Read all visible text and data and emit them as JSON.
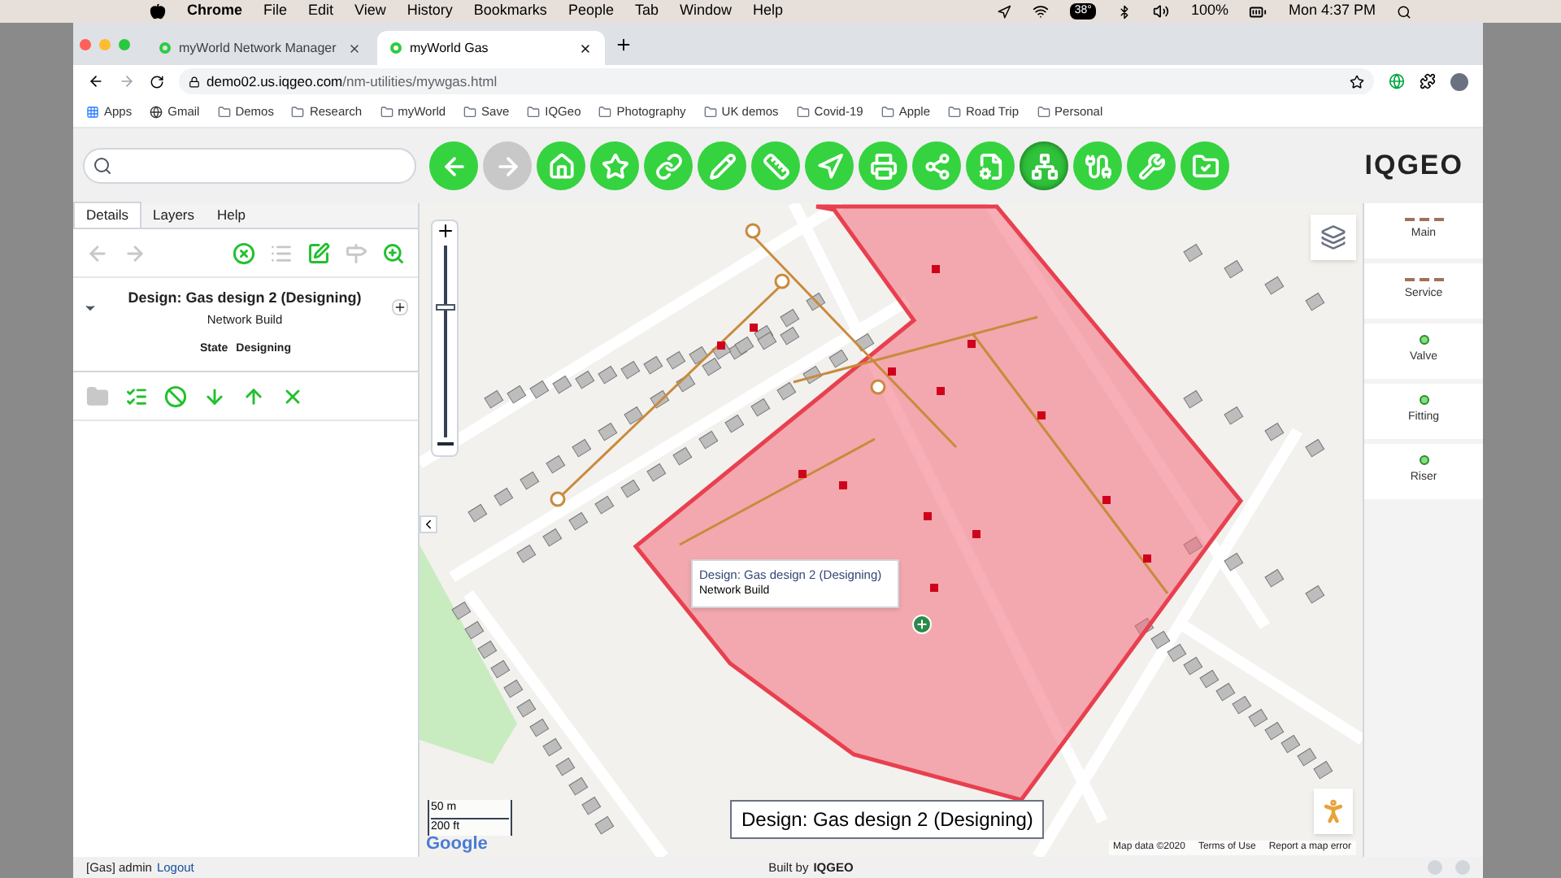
{
  "menu_bar": {
    "app": "Chrome",
    "items": [
      "File",
      "Edit",
      "View",
      "History",
      "Bookmarks",
      "People",
      "Tab",
      "Window",
      "Help"
    ],
    "temperature": "38°",
    "battery": "100%",
    "clock": "Mon 4:37 PM"
  },
  "browser_tabs": [
    {
      "title": "myWorld Network Manager",
      "selected": false
    },
    {
      "title": "myWorld Gas",
      "selected": true
    }
  ],
  "address_bar": {
    "host": "demo02.us.iqgeo.com",
    "path": "/nm-utilities/mywgas.html"
  },
  "bookmarks": [
    "Apps",
    "Gmail",
    "Demos",
    "Research",
    "myWorld",
    "Save",
    "IQGeo",
    "Photography",
    "UK demos",
    "Covid-19",
    "Apple",
    "Road Trip",
    "Personal"
  ],
  "toolbar": {
    "logo": "IQGEO",
    "tools": [
      {
        "disabled": false,
        "selected": false
      },
      {
        "disabled": true,
        "selected": false
      },
      {
        "disabled": false,
        "selected": false
      },
      {
        "disabled": false,
        "selected": false
      },
      {
        "disabled": false,
        "selected": false
      },
      {
        "disabled": false,
        "selected": false
      },
      {
        "disabled": false,
        "selected": false
      },
      {
        "disabled": false,
        "selected": false
      },
      {
        "disabled": false,
        "selected": false
      },
      {
        "disabled": false,
        "selected": false
      },
      {
        "disabled": false,
        "selected": false
      },
      {
        "disabled": false,
        "selected": true
      },
      {
        "disabled": false,
        "selected": false
      },
      {
        "disabled": false,
        "selected": false
      },
      {
        "disabled": false,
        "selected": false
      }
    ]
  },
  "left_panel": {
    "tabs": [
      {
        "label": "Details",
        "selected": true
      },
      {
        "label": "Layers",
        "selected": false
      },
      {
        "label": "Help",
        "selected": false
      }
    ],
    "nav_actions": [
      {
        "disabled": true
      },
      {
        "disabled": true
      },
      {
        "disabled": false
      },
      {
        "disabled": true
      },
      {
        "disabled": false
      },
      {
        "disabled": true
      },
      {
        "disabled": false
      }
    ],
    "design": {
      "title": "Design: Gas design 2 (Designing)",
      "subtitle": "Network Build",
      "expanded": true,
      "state_label": "State",
      "state_value": "Designing"
    },
    "design_actions": [
      {
        "disabled": true
      },
      {
        "disabled": false
      },
      {
        "disabled": false
      },
      {
        "disabled": false
      },
      {
        "disabled": false
      },
      {
        "disabled": false
      }
    ]
  },
  "map": {
    "tooltip": {
      "title": "Design: Gas design 2 (Designing)",
      "subtitle": "Network Build"
    },
    "design_label": "Design: Gas design 2 (Designing)",
    "scale_metric": "50 m",
    "scale_imperial": "200 ft",
    "provider": "Google",
    "attribution": [
      "Map data ©2020",
      "Terms of Use",
      "Report a map error"
    ]
  },
  "right_panel": {
    "items": [
      {
        "label": "Main",
        "kind": "line"
      },
      {
        "label": "Service",
        "kind": "line"
      },
      {
        "label": "Valve",
        "kind": "dot"
      },
      {
        "label": "Fitting",
        "kind": "dot"
      },
      {
        "label": "Riser",
        "kind": "dot"
      }
    ]
  },
  "status_bar": {
    "user": "[Gas] admin",
    "logout": "Logout",
    "built_by": "Built by",
    "logo": "IQGEO"
  }
}
